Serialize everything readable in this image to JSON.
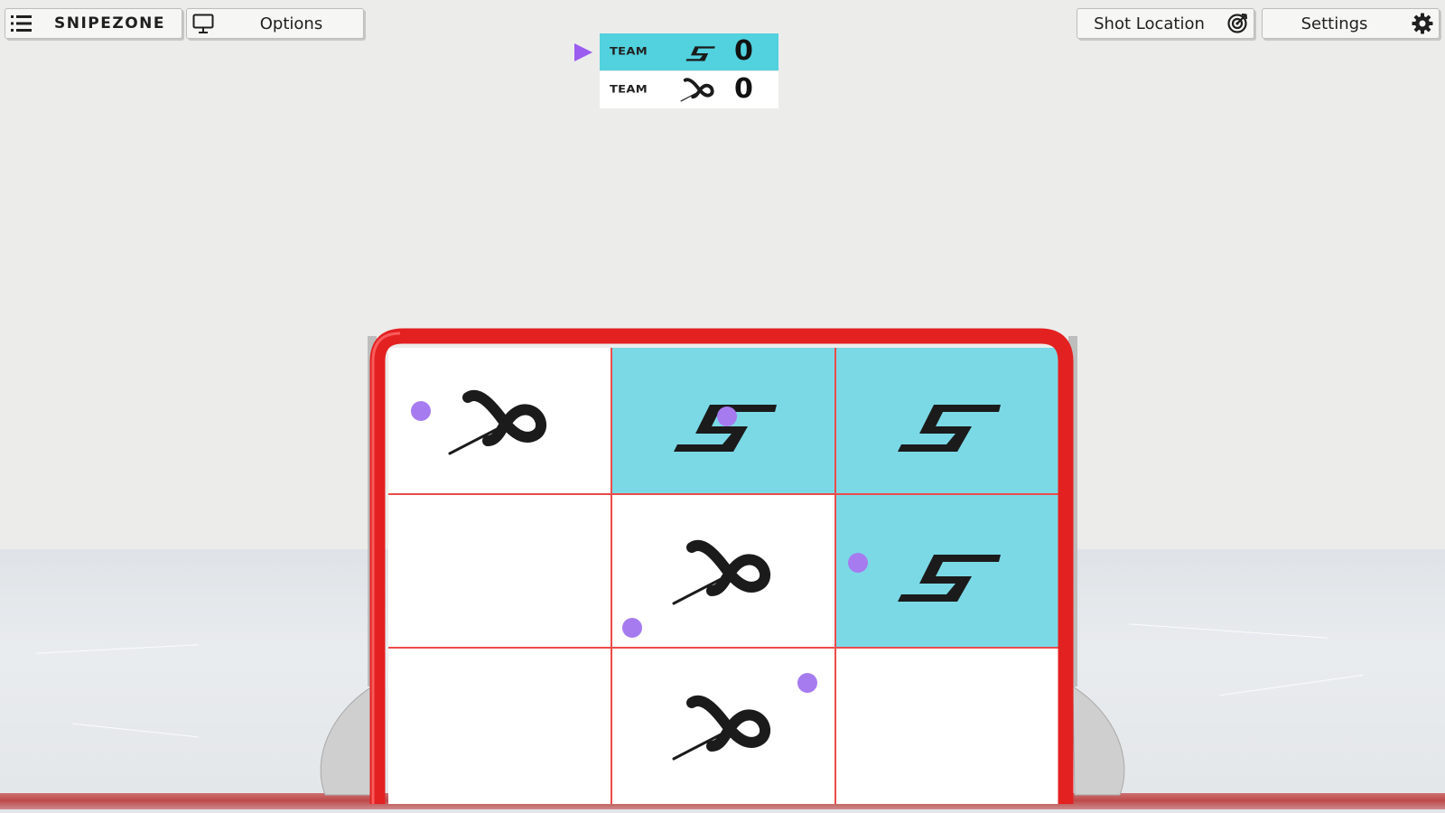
{
  "toolbar": {
    "menu_label": "SNIPEZONE",
    "options_label": "Options",
    "shot_location_label": "Shot Location",
    "settings_label": "Settings"
  },
  "scoreboard": {
    "active_team": 0,
    "teams": [
      {
        "label": "TEAM",
        "logo": "snipe-s-logo",
        "score": "0",
        "color": "#52d1de"
      },
      {
        "label": "TEAM",
        "logo": "infinity-swoosh-logo",
        "score": "0",
        "color": "#ffffff"
      }
    ]
  },
  "board": {
    "rows": 3,
    "cols": 3,
    "cells": [
      [
        "x-team",
        "s-team",
        "s-team"
      ],
      [
        "empty",
        "x-team",
        "s-team"
      ],
      [
        "empty",
        "x-team",
        "empty"
      ]
    ]
  },
  "colors": {
    "accent": "#9b5cf0",
    "s_team_fill": "#7bd9e6",
    "goal_frame": "#e32121",
    "puck": "#a77bf0"
  }
}
